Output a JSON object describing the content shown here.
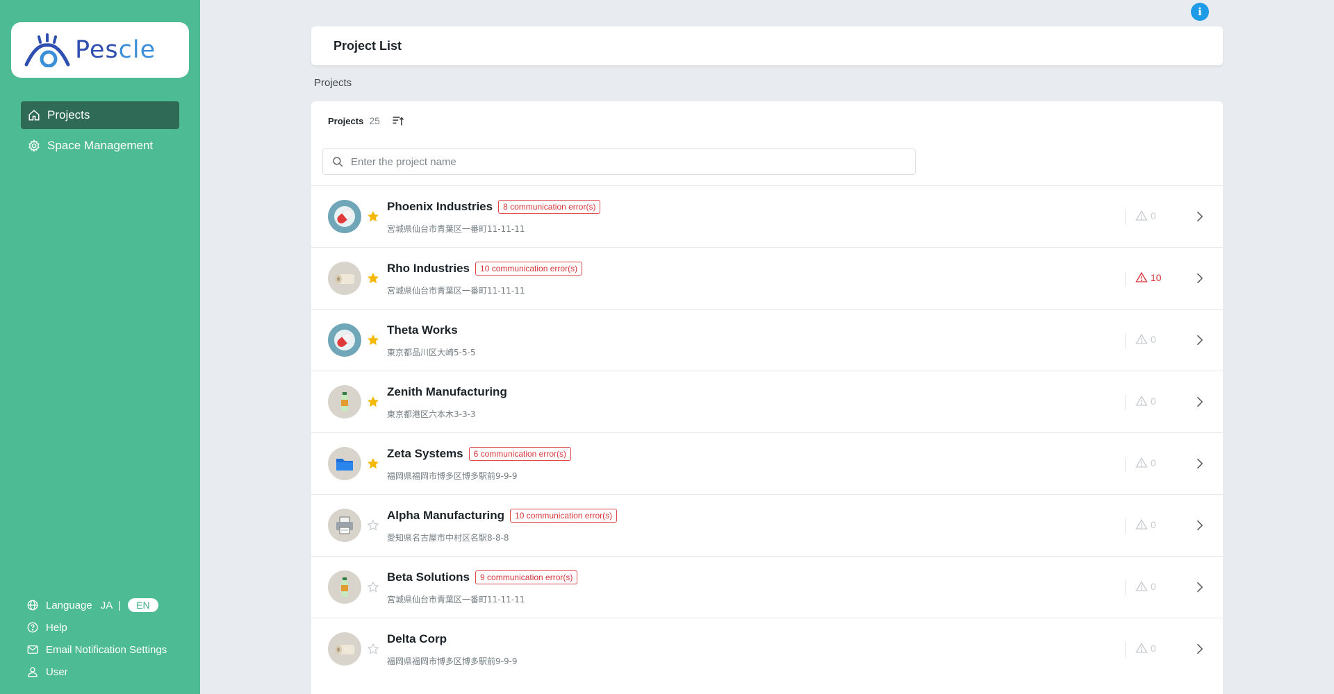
{
  "app": {
    "logo_text_a": "Pes",
    "logo_text_b": "cle",
    "info_label": "i"
  },
  "sidebar": {
    "nav": [
      {
        "label": "Projects",
        "icon": "home-icon",
        "active": true
      },
      {
        "label": "Space Management",
        "icon": "gear-icon",
        "active": false
      }
    ],
    "language_label": "Language",
    "lang_ja": "JA",
    "lang_sep": "|",
    "lang_en": "EN",
    "help_label": "Help",
    "email_label": "Email Notification Settings",
    "user_label": "User"
  },
  "header": {
    "title": "Project List"
  },
  "breadcrumb": "Projects",
  "list_header": {
    "label": "Projects",
    "count": "25"
  },
  "search": {
    "placeholder": "Enter the project name",
    "value": ""
  },
  "projects": [
    {
      "name": "Phoenix Industries",
      "badge": "8 communication error(s)",
      "address": "宮城県仙台市青葉区一番町11-11-11",
      "favorite": true,
      "alerts": "0",
      "alert_active": false,
      "icon": "pill-icon"
    },
    {
      "name": "Rho Industries",
      "badge": "10 communication error(s)",
      "address": "宮城県仙台市青葉区一番町11-11-11",
      "favorite": true,
      "alerts": "10",
      "alert_active": true,
      "icon": "roll-icon"
    },
    {
      "name": "Theta Works",
      "badge": "",
      "address": "東京都品川区大崎5-5-5",
      "favorite": true,
      "alerts": "0",
      "alert_active": false,
      "icon": "pill-icon"
    },
    {
      "name": "Zenith Manufacturing",
      "badge": "",
      "address": "東京都港区六本木3-3-3",
      "favorite": true,
      "alerts": "0",
      "alert_active": false,
      "icon": "bottle-icon"
    },
    {
      "name": "Zeta Systems",
      "badge": "6 communication error(s)",
      "address": "福岡県福岡市博多区博多駅前9-9-9",
      "favorite": true,
      "alerts": "0",
      "alert_active": false,
      "icon": "folder-icon"
    },
    {
      "name": "Alpha Manufacturing",
      "badge": "10 communication error(s)",
      "address": "愛知県名古屋市中村区名駅8-8-8",
      "favorite": false,
      "alerts": "0",
      "alert_active": false,
      "icon": "printer-icon"
    },
    {
      "name": "Beta Solutions",
      "badge": "9 communication error(s)",
      "address": "宮城県仙台市青葉区一番町11-11-11",
      "favorite": false,
      "alerts": "0",
      "alert_active": false,
      "icon": "bottle-icon"
    },
    {
      "name": "Delta Corp",
      "badge": "",
      "address": "福岡県福岡市博多区博多駅前9-9-9",
      "favorite": false,
      "alerts": "0",
      "alert_active": false,
      "icon": "roll-icon"
    }
  ],
  "colors": {
    "sidebar": "#4dbb94",
    "active_nav": "#2e6a55",
    "error": "#d9343a",
    "accent_blue": "#1e9be6"
  }
}
